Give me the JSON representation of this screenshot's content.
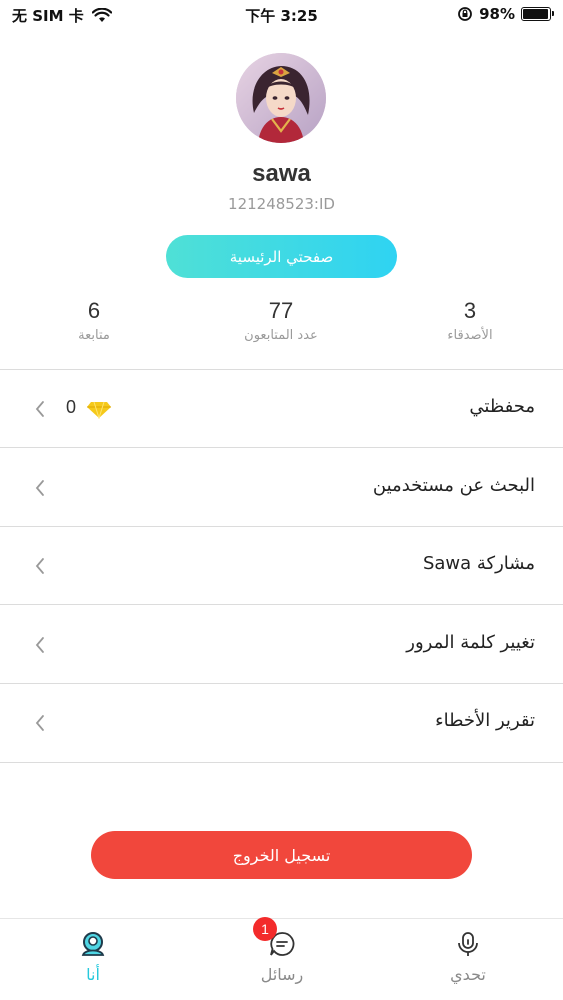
{
  "status_bar": {
    "carrier": "无 SIM 卡",
    "time": "下午 3:25",
    "battery": "98%",
    "battery_level": 0.98
  },
  "profile": {
    "username": "sawa",
    "user_id": "121248523:ID",
    "home_button": "صفحتي الرئيسية"
  },
  "stats": [
    {
      "value": "6",
      "label": "متابعة"
    },
    {
      "value": "77",
      "label": "عدد المتابعون"
    },
    {
      "value": "3",
      "label": "الأصدقاء"
    }
  ],
  "menu": {
    "wallet": {
      "label": "محفظتي",
      "value": "0"
    },
    "items": [
      {
        "label": "البحث عن مستخدمين"
      },
      {
        "label": "مشاركة Sawa"
      },
      {
        "label": "تغيير كلمة المرور"
      },
      {
        "label": "تقرير الأخطاء"
      }
    ]
  },
  "logout_button": "تسجيل الخروج",
  "tabs": [
    {
      "label": "أنا",
      "icon": "user-icon",
      "active": true
    },
    {
      "label": "رسائل",
      "icon": "message-icon",
      "badge": "1"
    },
    {
      "label": "تحدي",
      "icon": "microphone-icon"
    }
  ],
  "colors": {
    "accent": "#27c9dc",
    "logout": "#f1473c",
    "badge": "#f32b2b"
  }
}
